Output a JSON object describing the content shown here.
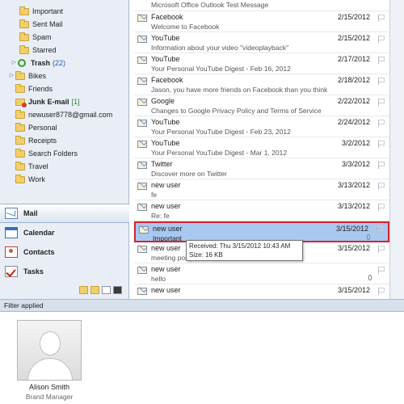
{
  "folders": [
    {
      "label": "Important"
    },
    {
      "label": "Sent Mail"
    },
    {
      "label": "Spam"
    },
    {
      "label": "Starred"
    },
    {
      "label": "Trash",
      "count": "(22)"
    },
    {
      "label": "Bikes"
    },
    {
      "label": "Friends"
    },
    {
      "label": "Junk E-mail",
      "count": "[1]"
    },
    {
      "label": "newuser8778@gmail.com"
    },
    {
      "label": "Personal"
    },
    {
      "label": "Receipts"
    },
    {
      "label": "Search Folders"
    },
    {
      "label": "Travel"
    },
    {
      "label": "Work"
    }
  ],
  "nav_buttons": {
    "mail": "Mail",
    "calendar": "Calendar",
    "contacts": "Contacts",
    "tasks": "Tasks"
  },
  "messages": [
    {
      "from": "",
      "date": "",
      "preview": "Microsoft Office Outlook Test Message"
    },
    {
      "from": "Facebook",
      "date": "2/15/2012",
      "preview": "Welcome to Facebook"
    },
    {
      "from": "YouTube",
      "date": "2/15/2012",
      "preview": "Information about your video \"videoplayback\""
    },
    {
      "from": "YouTube",
      "date": "2/17/2012",
      "preview": "Your Personal YouTube Digest - Feb 16, 2012"
    },
    {
      "from": "Facebook",
      "date": "2/18/2012",
      "preview": "Jason, you have more friends on Facebook than you think"
    },
    {
      "from": "Google",
      "date": "2/22/2012",
      "preview": "Changes to Google Privacy Policy and Terms of Service"
    },
    {
      "from": "YouTube",
      "date": "2/24/2012",
      "preview": "Your Personal YouTube Digest - Feb 23, 2012"
    },
    {
      "from": "YouTube",
      "date": "3/2/2012",
      "preview": "Your Personal YouTube Digest - Mar 1, 2012"
    },
    {
      "from": "Twitter",
      "date": "3/3/2012",
      "preview": "Discover more on Twitter"
    },
    {
      "from": "new user",
      "date": "3/13/2012",
      "preview": "fe"
    },
    {
      "from": "new user",
      "date": "3/13/2012",
      "preview": "Re: fe"
    },
    {
      "from": "new user",
      "date": "3/15/2012",
      "preview": "Important"
    },
    {
      "from": "new user",
      "date": "3/15/2012",
      "preview": "meeting postponed"
    },
    {
      "from": "new user",
      "date": "",
      "preview": "hello"
    },
    {
      "from": "new user",
      "date": "3/15/2012",
      "preview": ""
    }
  ],
  "tooltip": {
    "received": "Received: Thu 3/15/2012 10:43 AM",
    "size": "Size: 16 KB"
  },
  "statusbar": {
    "text": "Filter applied"
  },
  "person": {
    "name": "Alison Smith",
    "title": "Brand Manager"
  },
  "colors": {
    "selection": "#a9c8ef",
    "highlight_border": "#d8232a",
    "nav_bg": "#e9eef6"
  }
}
